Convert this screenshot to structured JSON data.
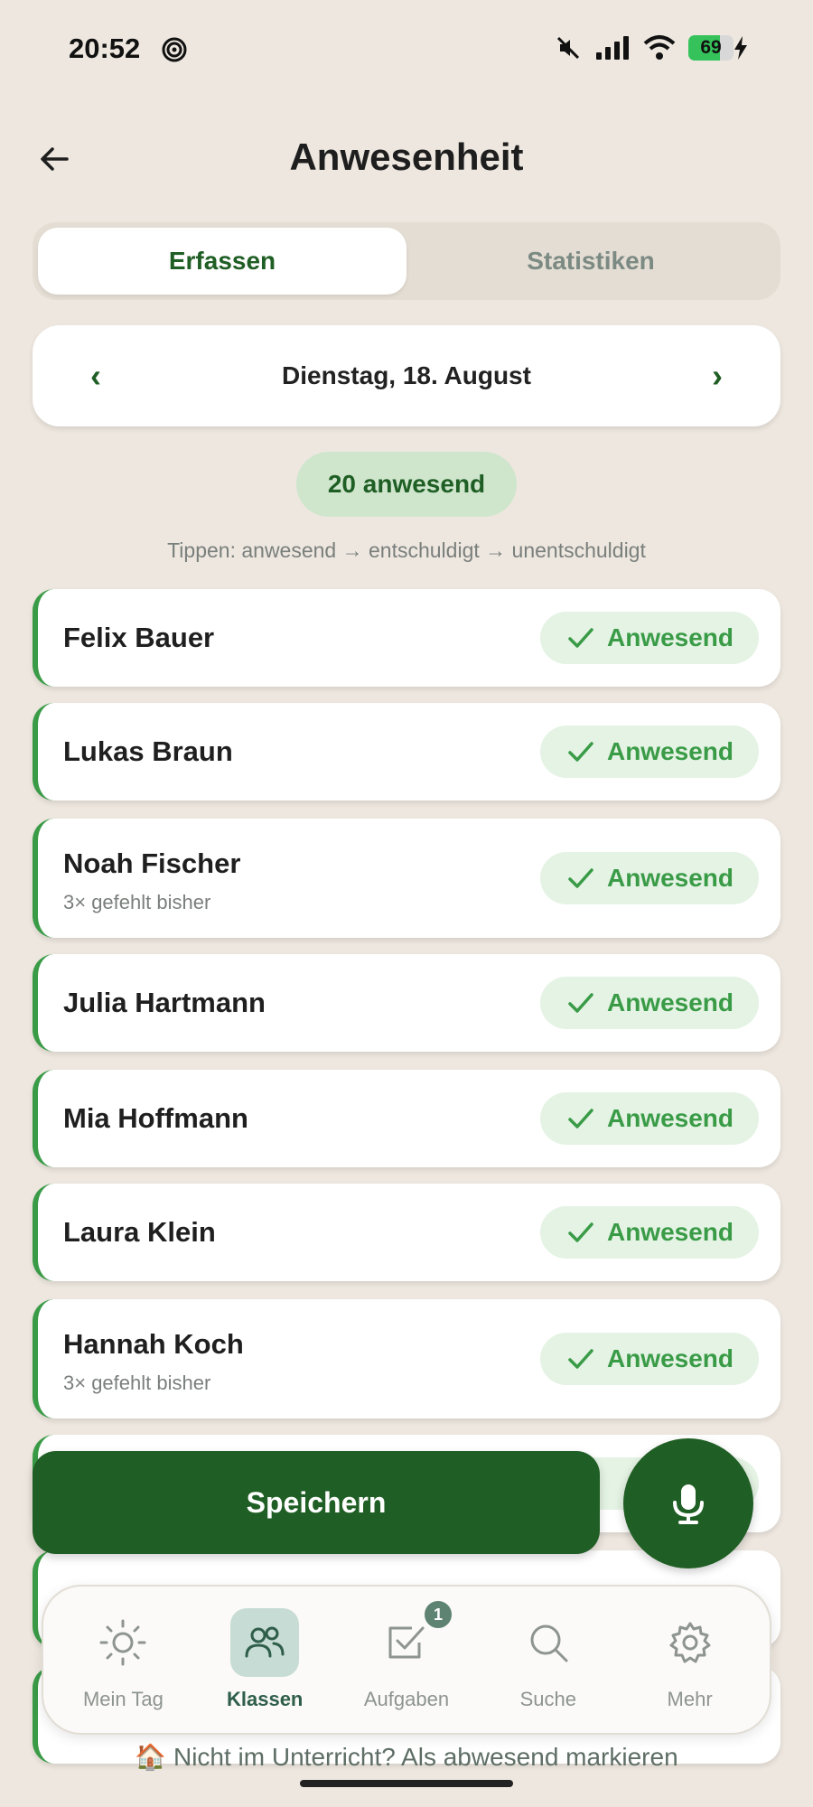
{
  "status_bar": {
    "time": "20:52",
    "battery": "69",
    "battery_level": 0.69
  },
  "header": {
    "title": "Anwesenheit"
  },
  "tabs": [
    {
      "label": "Erfassen",
      "active": true
    },
    {
      "label": "Statistiken",
      "active": false
    }
  ],
  "date_nav": {
    "prev": "‹",
    "date": "Dienstag, 18. August",
    "next": "›"
  },
  "summary": {
    "present_count": "20 anwesend",
    "hint": "Tippen: anwesend → entschuldigt → unentschuldigt"
  },
  "students": [
    {
      "name": "Felix Bauer",
      "note": "",
      "status": "Anwesend"
    },
    {
      "name": "Lukas Braun",
      "note": "",
      "status": "Anwesend"
    },
    {
      "name": "Noah Fischer",
      "note": "3× gefehlt bisher",
      "status": "Anwesend"
    },
    {
      "name": "Julia Hartmann",
      "note": "",
      "status": "Anwesend"
    },
    {
      "name": "Mia Hoffmann",
      "note": "",
      "status": "Anwesend"
    },
    {
      "name": "Laura Klein",
      "note": "",
      "status": "Anwesend"
    },
    {
      "name": "Hannah Koch",
      "note": "3× gefehlt bisher",
      "status": "Anwesend"
    }
  ],
  "actions": {
    "save": "Speichern"
  },
  "bottom_nav": [
    {
      "label": "Mein Tag",
      "icon": "sun-icon",
      "active": false
    },
    {
      "label": "Klassen",
      "icon": "people-icon",
      "active": true
    },
    {
      "label": "Aufgaben",
      "icon": "checkbox-icon",
      "active": false,
      "badge": "1"
    },
    {
      "label": "Suche",
      "icon": "search-icon",
      "active": false
    },
    {
      "label": "Mehr",
      "icon": "gear-icon",
      "active": false
    }
  ],
  "footer": {
    "absent_link": "🏠 Nicht im Unterricht? Als abwesend markieren"
  },
  "colors": {
    "background": "#ede7df",
    "primary": "#1f5e24",
    "present_green": "#3a9b47",
    "chip_bg": "#e4f3e4"
  }
}
